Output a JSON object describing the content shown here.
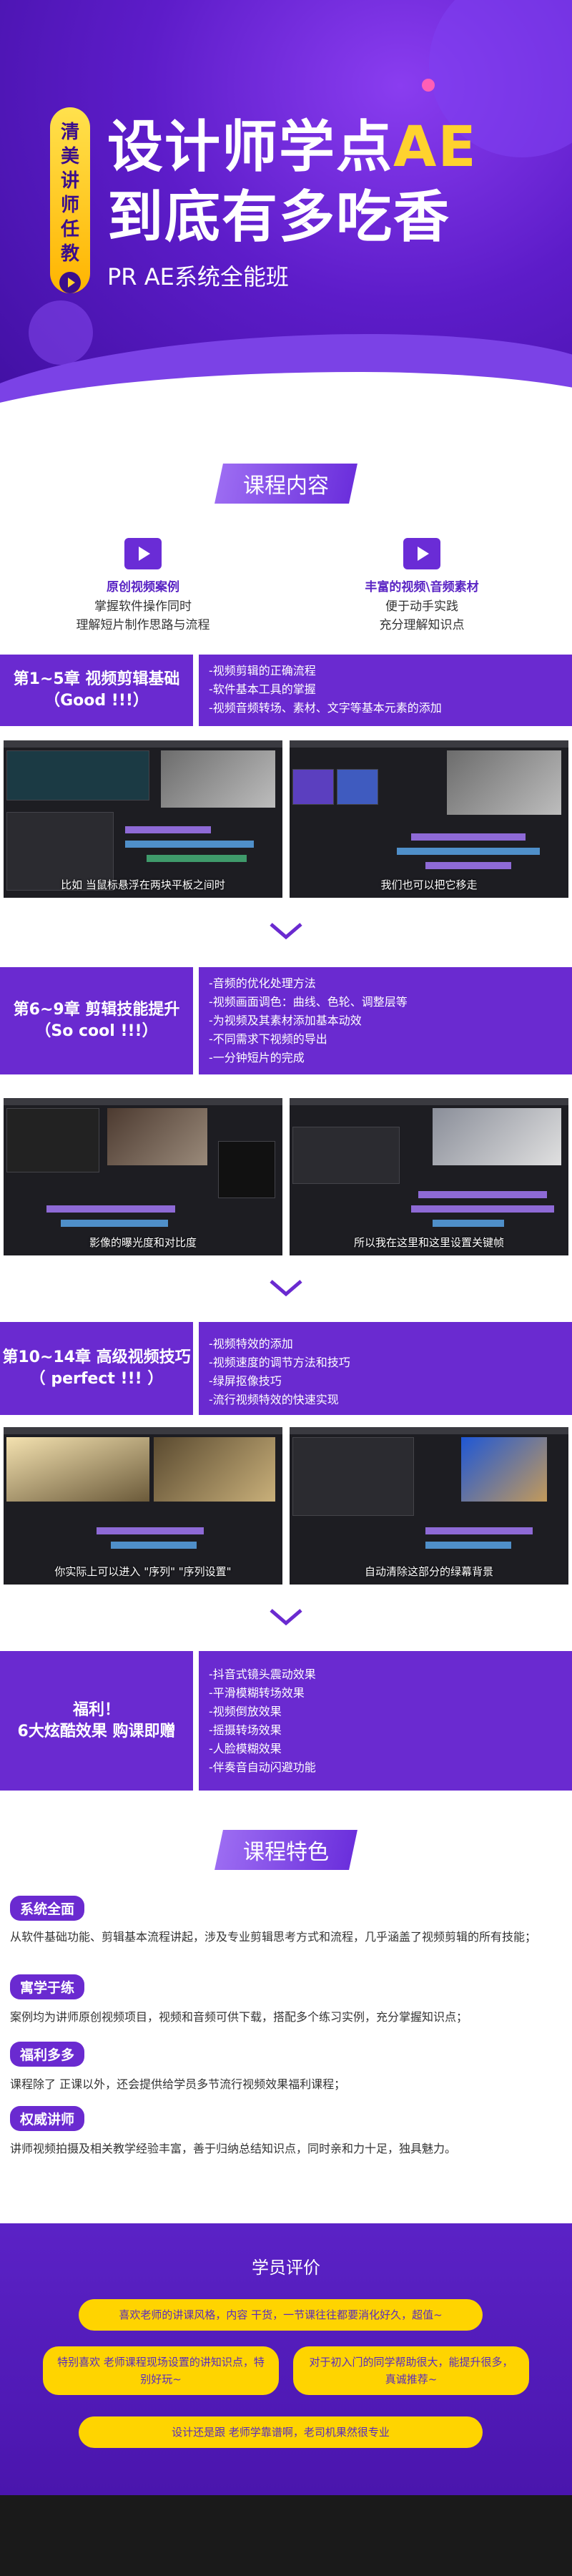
{
  "hero": {
    "tag_chars": [
      "清",
      "美",
      "讲",
      "师",
      "任",
      "教"
    ],
    "title_line1_a": "设计师学点",
    "title_line1_b": "AE",
    "title_line2": "到底有多吃香",
    "subtitle": "PR AE系统全能班"
  },
  "course_content": {
    "title": "课程内容",
    "features": [
      {
        "icon": "clapperboard-icon",
        "title": "原创视频案例",
        "lines": [
          "掌握软件操作同时",
          "理解短片制作思路与流程"
        ]
      },
      {
        "icon": "video-camera-icon",
        "title": "丰富的视频\\音频素材",
        "lines": [
          "便于动手实践",
          "充分理解知识点"
        ]
      }
    ]
  },
  "chapters": [
    {
      "label": [
        "第1~5章 视频剪辑基础",
        "（Good !!!）"
      ],
      "items": [
        "-视频剪辑的正确流程",
        "-软件基本工具的掌握",
        "-视频音频转场、素材、文字等基本元素的添加"
      ],
      "captions": [
        "比如 当鼠标悬浮在两块平板之间时",
        "我们也可以把它移走"
      ]
    },
    {
      "label": [
        "第6~9章 剪辑技能提升",
        "（So cool !!!）"
      ],
      "items": [
        "-音频的优化处理方法",
        "-视频画面调色：曲线、色轮、调整层等",
        "-为视频及其素材添加基本动效",
        "-不同需求下视频的导出",
        "-一分钟短片的完成"
      ],
      "captions": [
        "影像的曝光度和对比度",
        "所以我在这里和这里设置关键帧"
      ]
    },
    {
      "label": [
        "第10~14章 高级视频技巧",
        "（ perfect !!! ）"
      ],
      "items": [
        "-视频特效的添加",
        "-视频速度的调节方法和技巧",
        "-绿屏抠像技巧",
        "-流行视频特效的快速实现"
      ],
      "captions": [
        "你实际上可以进入 \"序列\" \"序列设置\"",
        "自动清除这部分的绿幕背景"
      ]
    },
    {
      "label": [
        "福利！",
        "6大炫酷效果 购课即赠"
      ],
      "items": [
        "-抖音式镜头震动效果",
        "-平滑模糊转场效果",
        "-视频倒放效果",
        "-摇摄转场效果",
        "-人脸模糊效果",
        "-伴奏音自动闪避功能"
      ],
      "captions": []
    }
  ],
  "course_features": {
    "title": "课程特色",
    "items": [
      {
        "tag": "系统全面",
        "text": "从软件基础功能、剪辑基本流程讲起，涉及专业剪辑思考方式和流程，几乎涵盖了视频剪辑的所有技能；"
      },
      {
        "tag": "寓学于练",
        "text": "案例均为讲师原创视频项目，视频和音频可供下载，搭配多个练习实例，充分掌握知识点；"
      },
      {
        "tag": "福利多多",
        "text": "课程除了  正课以外，还会提供给学员多节流行视频效果福利课程；"
      },
      {
        "tag": "权威讲师",
        "text": "讲师视频拍摄及相关教学经验丰富，善于归纳总结知识点，同时亲和力十足，独具魅力。"
      }
    ]
  },
  "reviews": {
    "title": "学员评价",
    "bubbles": [
      "喜欢老师的讲课风格，内容    干货，一节课往往都要消化好久，超值~",
      "特别喜欢 老师课程现场设置的讲知识点，特别好玩~",
      "对于初入门的同学帮助很大，能提升很多，真诚推荐~",
      "设计还是跟 老师学靠谱啊，老司机果然很专业"
    ]
  },
  "colors": {
    "brand_purple": "#6a2ad0",
    "accent_yellow": "#ffd400"
  }
}
